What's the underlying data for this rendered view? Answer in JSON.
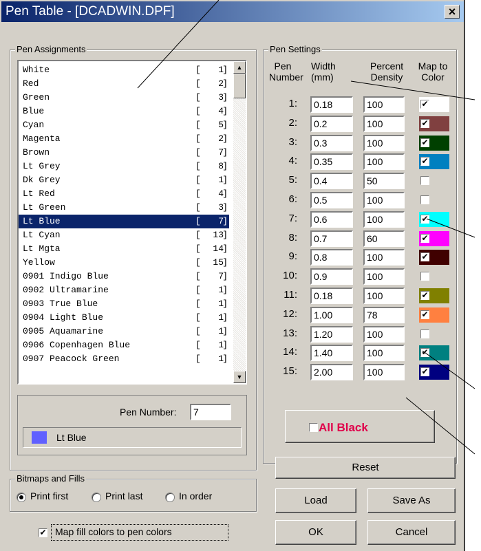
{
  "window": {
    "title": "Pen Table - [DCADWIN.DPF]",
    "close_glyph": "×"
  },
  "pen_assignments": {
    "label": "Pen Assignments",
    "items": [
      {
        "name": "White",
        "pen": "1"
      },
      {
        "name": "Red",
        "pen": "2"
      },
      {
        "name": "Green",
        "pen": "3"
      },
      {
        "name": "Blue",
        "pen": "4"
      },
      {
        "name": "Cyan",
        "pen": "5"
      },
      {
        "name": "Magenta",
        "pen": "2"
      },
      {
        "name": "Brown",
        "pen": "7"
      },
      {
        "name": "Lt Grey",
        "pen": "8"
      },
      {
        "name": "Dk Grey",
        "pen": "1"
      },
      {
        "name": "Lt Red",
        "pen": "4"
      },
      {
        "name": "Lt Green",
        "pen": "3"
      },
      {
        "name": "Lt Blue",
        "pen": "7",
        "selected": true
      },
      {
        "name": "Lt Cyan",
        "pen": "13"
      },
      {
        "name": "Lt Mgta",
        "pen": "14"
      },
      {
        "name": "Yellow",
        "pen": "15"
      },
      {
        "name": "0901 Indigo Blue",
        "pen": "7"
      },
      {
        "name": "0902 Ultramarine",
        "pen": "1"
      },
      {
        "name": "0903 True Blue",
        "pen": "1"
      },
      {
        "name": "0904 Light Blue",
        "pen": "1"
      },
      {
        "name": "0905 Aquamarine",
        "pen": "1"
      },
      {
        "name": "0906 Copenhagen Blue",
        "pen": "1"
      },
      {
        "name": "0907 Peacock Green",
        "pen": "1"
      }
    ],
    "pen_number_label": "Pen Number:",
    "pen_number_value": "7",
    "selected_color_name": "Lt Blue",
    "selected_color_hex": "#6060ff"
  },
  "pen_settings": {
    "label": "Pen Settings",
    "headers": {
      "pen": "Pen",
      "number": "Number",
      "width": "Width",
      "mm": "(mm)",
      "percent": "Percent",
      "density": "Density",
      "map_to": "Map to",
      "color": "Color"
    },
    "rows": [
      {
        "pen": "1:",
        "width": "0.18",
        "density": "100",
        "checked": true,
        "color": "#ffffff"
      },
      {
        "pen": "2:",
        "width": "0.2",
        "density": "100",
        "checked": true,
        "color": "#804040"
      },
      {
        "pen": "3:",
        "width": "0.3",
        "density": "100",
        "checked": true,
        "color": "#004000"
      },
      {
        "pen": "4:",
        "width": "0.35",
        "density": "100",
        "checked": true,
        "color": "#0080c0"
      },
      {
        "pen": "5:",
        "width": "0.4",
        "density": "50",
        "checked": false,
        "color": ""
      },
      {
        "pen": "6:",
        "width": "0.5",
        "density": "100",
        "checked": false,
        "color": ""
      },
      {
        "pen": "7:",
        "width": "0.6",
        "density": "100",
        "checked": true,
        "color": "#00ffff"
      },
      {
        "pen": "8:",
        "width": "0.7",
        "density": "60",
        "checked": true,
        "color": "#ff00ff"
      },
      {
        "pen": "9:",
        "width": "0.8",
        "density": "100",
        "checked": true,
        "color": "#400000"
      },
      {
        "pen": "10:",
        "width": "0.9",
        "density": "100",
        "checked": false,
        "color": ""
      },
      {
        "pen": "11:",
        "width": "0.18",
        "density": "100",
        "checked": true,
        "color": "#808000"
      },
      {
        "pen": "12:",
        "width": "1.00",
        "density": "78",
        "checked": true,
        "color": "#ff8040"
      },
      {
        "pen": "13:",
        "width": "1.20",
        "density": "100",
        "checked": false,
        "color": ""
      },
      {
        "pen": "14:",
        "width": "1.40",
        "density": "100",
        "checked": true,
        "color": "#008080"
      },
      {
        "pen": "15:",
        "width": "2.00",
        "density": "100",
        "checked": true,
        "color": "#000080"
      }
    ],
    "all_black_label": "All Black",
    "all_black_checked": false
  },
  "bitmaps": {
    "label": "Bitmaps and Fills",
    "options": [
      "Print first",
      "Print last",
      "In order"
    ],
    "selected": "Print first",
    "map_fill_label": "Map fill colors to pen colors",
    "map_fill_checked": true
  },
  "buttons": {
    "reset": "Reset",
    "load": "Load",
    "save_as": "Save As",
    "ok": "OK",
    "cancel": "Cancel"
  },
  "check_glyph": "✔"
}
